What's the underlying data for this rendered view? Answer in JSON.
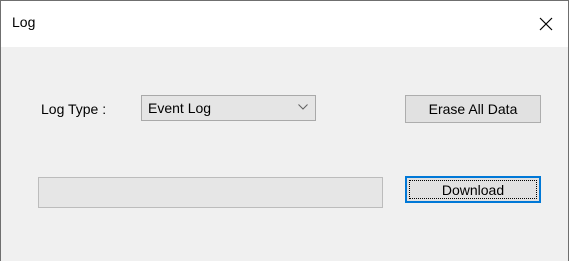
{
  "window": {
    "title": "Log"
  },
  "close_icon": "close-icon",
  "form": {
    "log_type_label": "Log Type :",
    "log_type_selected": "Event Log",
    "erase_button_label": "Erase All Data",
    "download_button_label": "Download"
  },
  "progress": {
    "value": 0
  },
  "colors": {
    "focus_border": "#0078d7",
    "dialog_background": "#f0f0f0"
  }
}
